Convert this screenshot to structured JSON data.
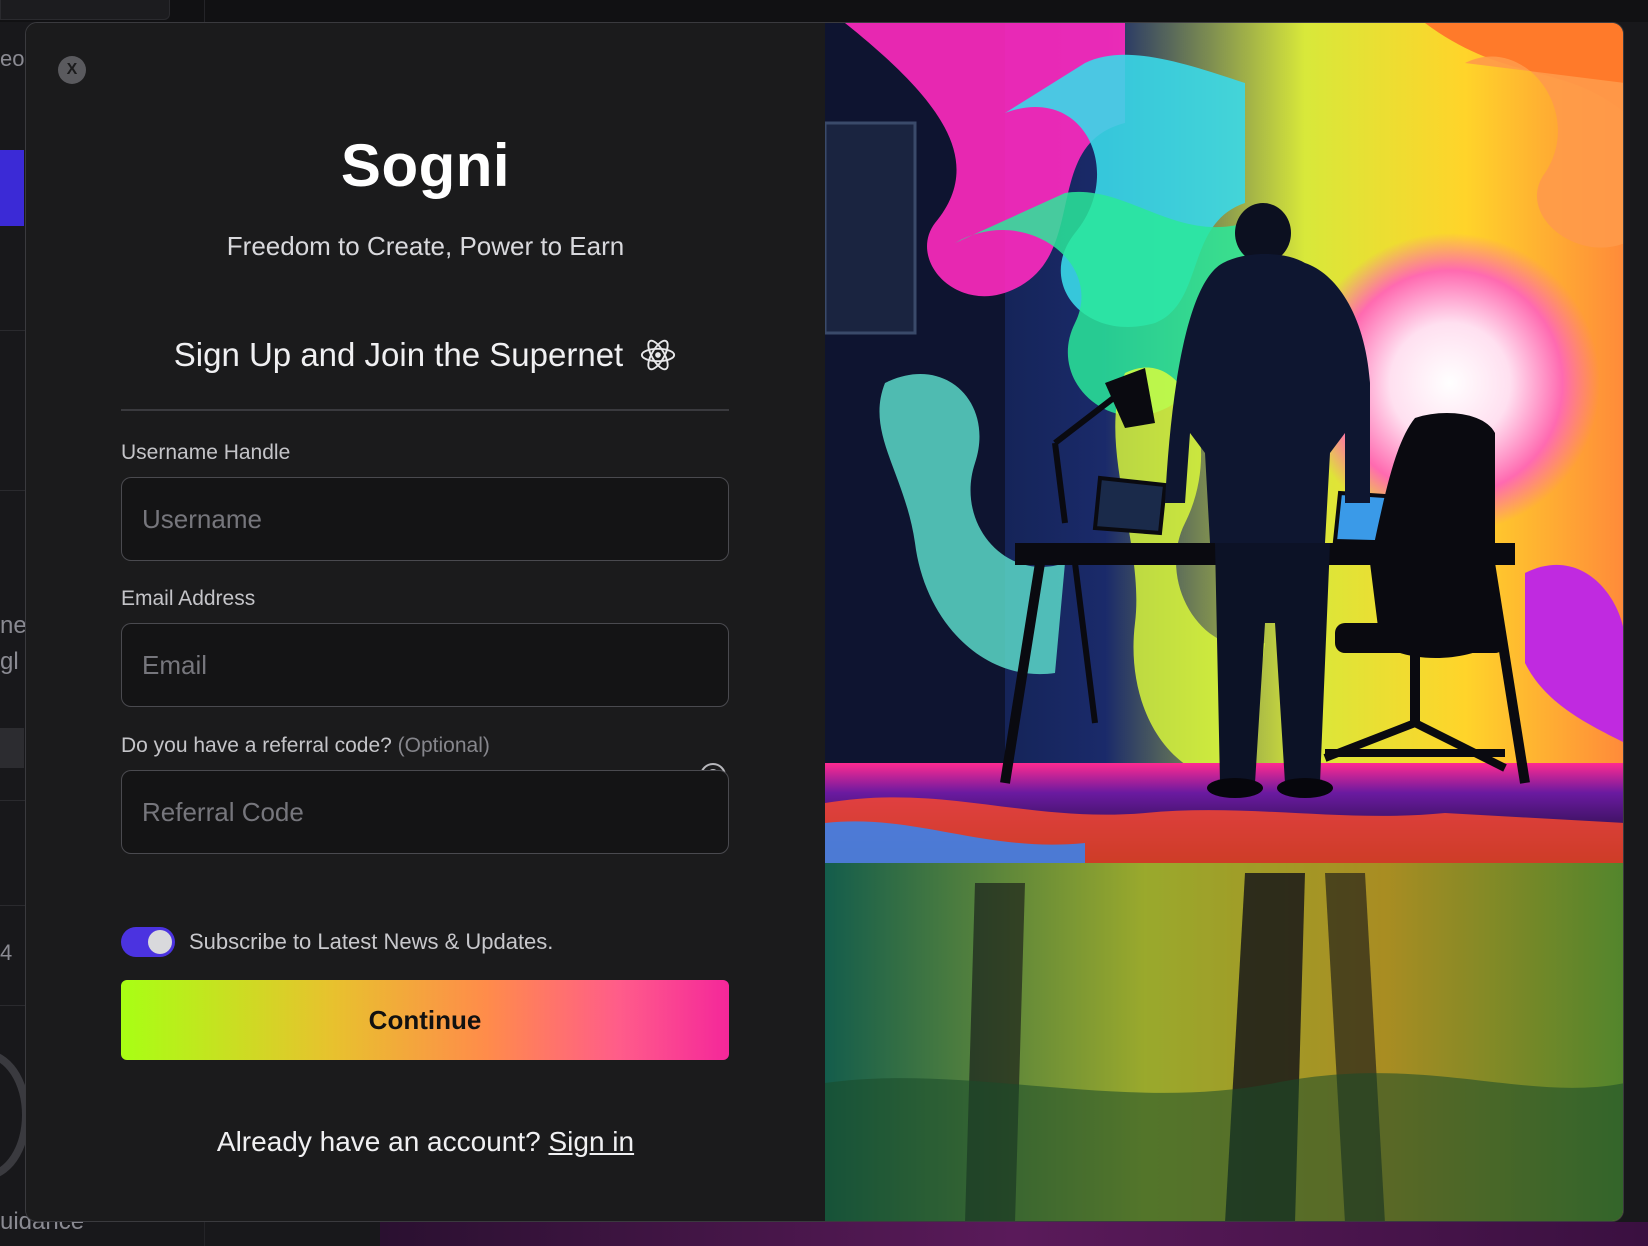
{
  "background_app": {
    "partial_texts": [
      "eo",
      "ne",
      "gl",
      "4",
      "uidance"
    ]
  },
  "modal": {
    "close_label": "X",
    "brand": "Sogni",
    "tagline": "Freedom to Create, Power to Earn",
    "heading": "Sign Up and Join the Supernet",
    "heading_icon": "atom-icon",
    "fields": {
      "username": {
        "label": "Username Handle",
        "placeholder": "Username",
        "value": ""
      },
      "email": {
        "label": "Email Address",
        "placeholder": "Email",
        "value": ""
      },
      "referral": {
        "label": "Do you have a referral code?",
        "optional": "(Optional)",
        "placeholder": "Referral Code",
        "value": "",
        "help_icon": "question-circle-icon"
      }
    },
    "subscribe": {
      "label": "Subscribe to Latest News & Updates.",
      "enabled": true
    },
    "continue_label": "Continue",
    "signin_prompt": "Already have an account?",
    "signin_link": "Sign in",
    "illustration": "Hooded figure standing at a desk in a room bursting with neon paint"
  },
  "colors": {
    "toggle_on": "#4b33e0",
    "button_gradient_start": "#a8ff14",
    "button_gradient_end": "#f5279a",
    "modal_bg": "#1b1b1c"
  }
}
